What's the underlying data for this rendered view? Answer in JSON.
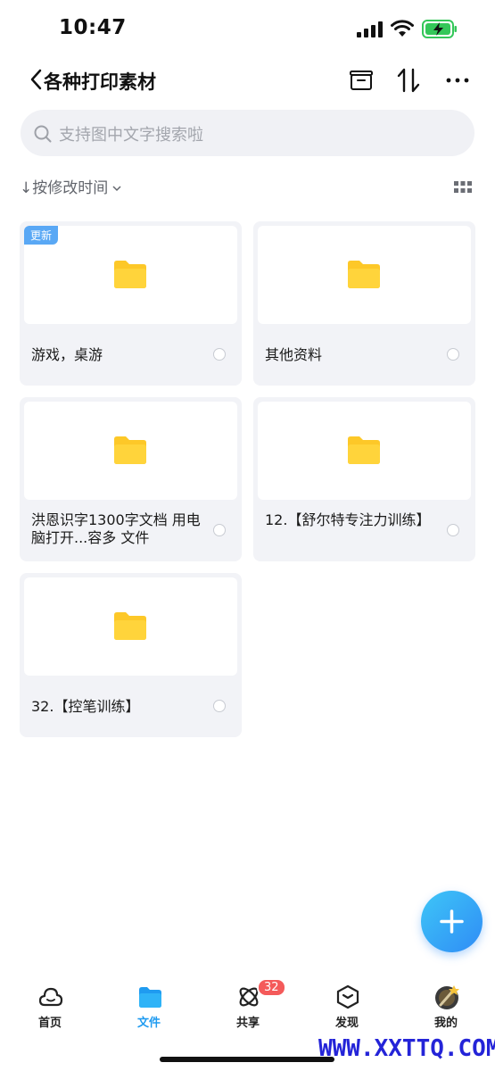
{
  "status_bar": {
    "time": "10:47"
  },
  "header": {
    "title": "各种打印素材"
  },
  "search": {
    "placeholder": "支持图中文字搜索啦"
  },
  "sort": {
    "label": "按修改时间"
  },
  "files": [
    {
      "name": "游戏，桌游",
      "badge": "更新"
    },
    {
      "name": "其他资料"
    },
    {
      "name": "洪恩识字1300字文档 用电脑打开...容多 文件"
    },
    {
      "name": "12.【舒尔特专注力训练】"
    },
    {
      "name": "32.【控笔训练】"
    }
  ],
  "tabbar": {
    "items": [
      {
        "label": "首页",
        "icon": "cloud-icon"
      },
      {
        "label": "文件",
        "icon": "folder-icon"
      },
      {
        "label": "共享",
        "icon": "share-icon",
        "badge": "32"
      },
      {
        "label": "发现",
        "icon": "cube-icon"
      },
      {
        "label": "我的",
        "icon": "avatar"
      }
    ]
  },
  "watermark": "WWW.XXTTQ.COM",
  "colors": {
    "accent": "#1f9bf0",
    "folder": "#fdc828",
    "badge_new": "#59a8f5",
    "tab_badge": "#f45a5a"
  }
}
